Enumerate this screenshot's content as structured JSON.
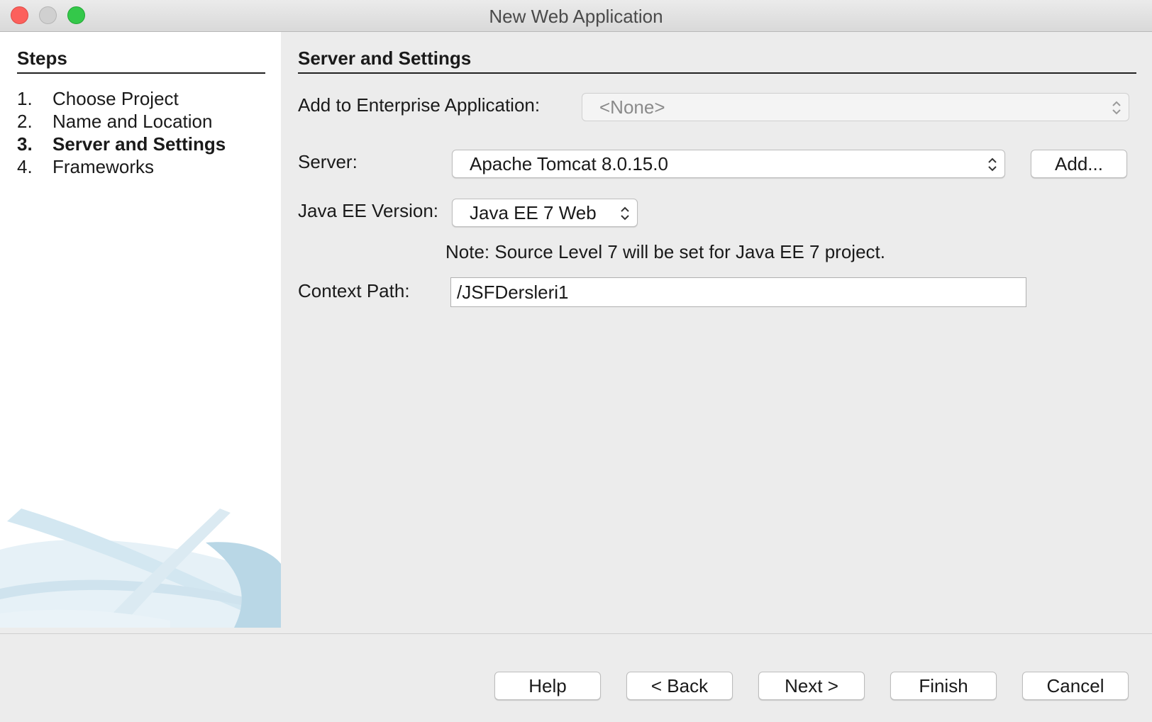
{
  "window": {
    "title": "New Web Application"
  },
  "steps": {
    "title": "Steps",
    "items": [
      {
        "num": "1.",
        "label": "Choose Project"
      },
      {
        "num": "2.",
        "label": "Name and Location"
      },
      {
        "num": "3.",
        "label": "Server and Settings"
      },
      {
        "num": "4.",
        "label": "Frameworks"
      }
    ],
    "active_index": 2
  },
  "panel": {
    "title": "Server and Settings",
    "enterprise": {
      "label": "Add to Enterprise Application:",
      "value": "<None>"
    },
    "server": {
      "label": "Server:",
      "value": "Apache Tomcat 8.0.15.0",
      "add_label": "Add..."
    },
    "javaee": {
      "label": "Java EE Version:",
      "value": "Java EE 7 Web"
    },
    "note": "Note: Source Level 7 will be set for Java EE 7 project.",
    "context_path": {
      "label": "Context Path:",
      "value": "/JSFDersleri1"
    }
  },
  "buttons": {
    "help": "Help",
    "back": "< Back",
    "next": "Next >",
    "finish": "Finish",
    "cancel": "Cancel"
  },
  "colors": {
    "close": "#fc605c",
    "minimize": "#d0d0d0",
    "maximize": "#34c84a",
    "sidebar_bg": "#ffffff",
    "window_bg": "#ececec"
  }
}
